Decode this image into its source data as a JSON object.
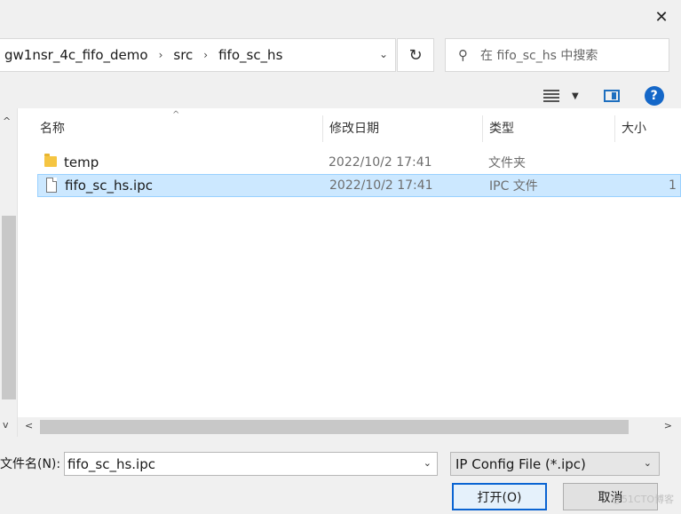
{
  "breadcrumb": {
    "items": [
      "gw1nsr_4c_fifo_demo",
      "src",
      "fifo_sc_hs"
    ]
  },
  "search": {
    "placeholder": "在 fifo_sc_hs 中搜索"
  },
  "columns": {
    "name": "名称",
    "date": "修改日期",
    "type": "类型",
    "size": "大小"
  },
  "files": [
    {
      "name": "temp",
      "date": "2022/10/2 17:41",
      "type": "文件夹",
      "size": "",
      "kind": "folder"
    },
    {
      "name": "fifo_sc_hs.ipc",
      "date": "2022/10/2 17:41",
      "type": "IPC 文件",
      "size": "1",
      "kind": "file"
    }
  ],
  "filename": {
    "label": "文件名(N):",
    "value": "fifo_sc_hs.ipc"
  },
  "filter": {
    "selected": "IP Config File (*.ipc)"
  },
  "buttons": {
    "open": "打开(O)",
    "cancel": "取消"
  },
  "watermark": "@51CTO博客",
  "colors": {
    "selection_bg": "#cce8ff",
    "selection_border": "#99d1ff",
    "accent": "#0a64d2",
    "help": "#1467c8"
  }
}
